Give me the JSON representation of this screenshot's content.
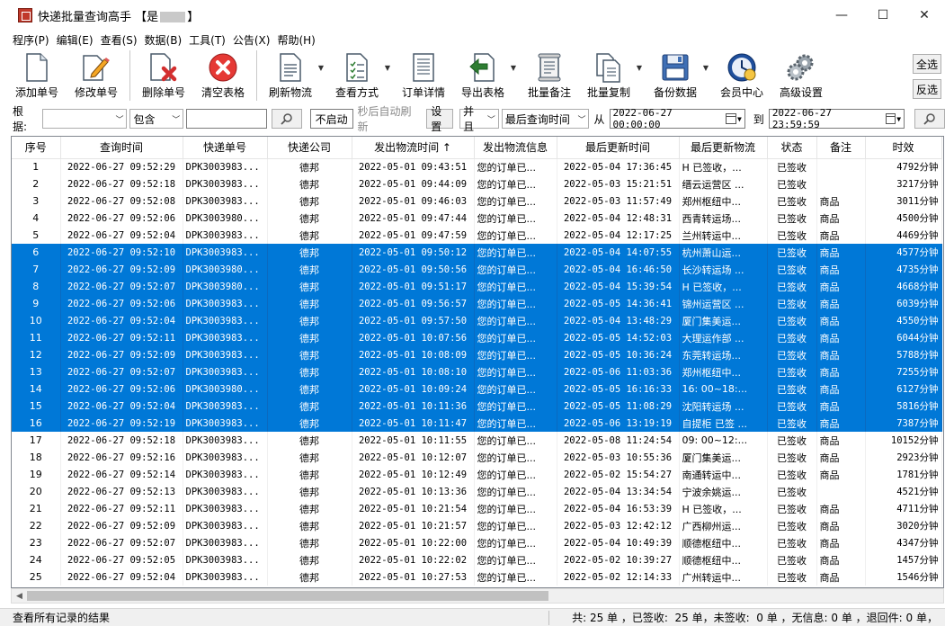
{
  "window": {
    "title_prefix": "快递批量查询高手 【是",
    "title_suffix": "】",
    "minimize": "—",
    "maximize": "☐",
    "close": "✕"
  },
  "menu": [
    "程序(P)",
    "编辑(E)",
    "查看(S)",
    "数据(B)",
    "工具(T)",
    "公告(X)",
    "帮助(H)"
  ],
  "toolbar": {
    "add": "添加单号",
    "edit": "修改单号",
    "delete": "删除单号",
    "clear": "清空表格",
    "refresh": "刷新物流",
    "view": "查看方式",
    "detail": "订单详情",
    "export": "导出表格",
    "batch_note": "批量备注",
    "batch_copy": "批量复制",
    "backup": "备份数据",
    "member": "会员中心",
    "advanced": "高级设置",
    "select_all": "全选",
    "invert": "反选"
  },
  "filter": {
    "basis_label": "根据:",
    "basis_value": "",
    "match_value": "包含",
    "search_text": "",
    "auto_toggle": "不启动",
    "auto_hint": "秒后自动刷新",
    "settings": "设置",
    "logic": "并且",
    "time_field": "最后查询时间",
    "from_label": "从",
    "from_date": "2022-06-27 00:00:00",
    "to_label": "到",
    "to_date": "2022-06-27 23:59:59"
  },
  "columns": [
    "序号",
    "查询时间",
    "快递单号",
    "快递公司",
    "发出物流时间 ↑",
    "发出物流信息",
    "最后更新时间",
    "最后更新物流",
    "状态",
    "备注",
    "时效"
  ],
  "rows": [
    [
      "1",
      "2022-06-27 09:52:29",
      "DPK3003983...",
      "德邦",
      "2022-05-01 09:43:51",
      "您的订单已...",
      "2022-05-04 17:36:45",
      "H 已签收，...",
      "已签收",
      "",
      "4792分钟"
    ],
    [
      "2",
      "2022-06-27 09:52:18",
      "DPK3003983...",
      "德邦",
      "2022-05-01 09:44:09",
      "您的订单已...",
      "2022-05-03 15:21:51",
      "缙云运营区 ...",
      "已签收",
      "",
      "3217分钟"
    ],
    [
      "3",
      "2022-06-27 09:52:08",
      "DPK3003983...",
      "德邦",
      "2022-05-01 09:46:03",
      "您的订单已...",
      "2022-05-03 11:57:49",
      "郑州枢纽中...",
      "已签收",
      "商品",
      "3011分钟"
    ],
    [
      "4",
      "2022-06-27 09:52:06",
      "DPK3003980...",
      "德邦",
      "2022-05-01 09:47:44",
      "您的订单已...",
      "2022-05-04 12:48:31",
      "西青转运场...",
      "已签收",
      "商品",
      "4500分钟"
    ],
    [
      "5",
      "2022-06-27 09:52:04",
      "DPK3003983...",
      "德邦",
      "2022-05-01 09:47:59",
      "您的订单已...",
      "2022-05-04 12:17:25",
      "兰州转运中...",
      "已签收",
      "商品",
      "4469分钟"
    ],
    [
      "6",
      "2022-06-27 09:52:10",
      "DPK3003983...",
      "德邦",
      "2022-05-01 09:50:12",
      "您的订单已...",
      "2022-05-04 14:07:55",
      "杭州萧山运...",
      "已签收",
      "商品",
      "4577分钟"
    ],
    [
      "7",
      "2022-06-27 09:52:09",
      "DPK3003980...",
      "德邦",
      "2022-05-01 09:50:56",
      "您的订单已...",
      "2022-05-04 16:46:50",
      "长沙转运场 ...",
      "已签收",
      "商品",
      "4735分钟"
    ],
    [
      "8",
      "2022-06-27 09:52:07",
      "DPK3003980...",
      "德邦",
      "2022-05-01 09:51:17",
      "您的订单已...",
      "2022-05-04 15:39:54",
      "H 已签收，...",
      "已签收",
      "商品",
      "4668分钟"
    ],
    [
      "9",
      "2022-06-27 09:52:06",
      "DPK3003983...",
      "德邦",
      "2022-05-01 09:56:57",
      "您的订单已...",
      "2022-05-05 14:36:41",
      "锦州运营区 ...",
      "已签收",
      "商品",
      "6039分钟"
    ],
    [
      "10",
      "2022-06-27 09:52:04",
      "DPK3003983...",
      "德邦",
      "2022-05-01 09:57:50",
      "您的订单已...",
      "2022-05-04 13:48:29",
      "厦门集美运...",
      "已签收",
      "商品",
      "4550分钟"
    ],
    [
      "11",
      "2022-06-27 09:52:11",
      "DPK3003983...",
      "德邦",
      "2022-05-01 10:07:56",
      "您的订单已...",
      "2022-05-05 14:52:03",
      "大理运作部 ...",
      "已签收",
      "商品",
      "6044分钟"
    ],
    [
      "12",
      "2022-06-27 09:52:09",
      "DPK3003983...",
      "德邦",
      "2022-05-01 10:08:09",
      "您的订单已...",
      "2022-05-05 10:36:24",
      "东莞转运场...",
      "已签收",
      "商品",
      "5788分钟"
    ],
    [
      "13",
      "2022-06-27 09:52:07",
      "DPK3003983...",
      "德邦",
      "2022-05-01 10:08:10",
      "您的订单已...",
      "2022-05-06 11:03:36",
      "郑州枢纽中...",
      "已签收",
      "商品",
      "7255分钟"
    ],
    [
      "14",
      "2022-06-27 09:52:06",
      "DPK3003980...",
      "德邦",
      "2022-05-01 10:09:24",
      "您的订单已...",
      "2022-05-05 16:16:33",
      "16: 00~18:...",
      "已签收",
      "商品",
      "6127分钟"
    ],
    [
      "15",
      "2022-06-27 09:52:04",
      "DPK3003983...",
      "德邦",
      "2022-05-01 10:11:36",
      "您的订单已...",
      "2022-05-05 11:08:29",
      "沈阳转运场 ...",
      "已签收",
      "商品",
      "5816分钟"
    ],
    [
      "16",
      "2022-06-27 09:52:19",
      "DPK3003983...",
      "德邦",
      "2022-05-01 10:11:47",
      "您的订单已...",
      "2022-05-06 13:19:19",
      "自提柜 已签 ...",
      "已签收",
      "商品",
      "7387分钟"
    ],
    [
      "17",
      "2022-06-27 09:52:18",
      "DPK3003983...",
      "德邦",
      "2022-05-01 10:11:55",
      "您的订单已...",
      "2022-05-08 11:24:54",
      "09: 00~12:...",
      "已签收",
      "商品",
      "10152分钟"
    ],
    [
      "18",
      "2022-06-27 09:52:16",
      "DPK3003983...",
      "德邦",
      "2022-05-01 10:12:07",
      "您的订单已...",
      "2022-05-03 10:55:36",
      "厦门集美运...",
      "已签收",
      "商品",
      "2923分钟"
    ],
    [
      "19",
      "2022-06-27 09:52:14",
      "DPK3003983...",
      "德邦",
      "2022-05-01 10:12:49",
      "您的订单已...",
      "2022-05-02 15:54:27",
      "南通转运中...",
      "已签收",
      "商品",
      "1781分钟"
    ],
    [
      "20",
      "2022-06-27 09:52:13",
      "DPK3003983...",
      "德邦",
      "2022-05-01 10:13:36",
      "您的订单已...",
      "2022-05-04 13:34:54",
      "宁波余姚运...",
      "已签收",
      "",
      "4521分钟"
    ],
    [
      "21",
      "2022-06-27 09:52:11",
      "DPK3003983...",
      "德邦",
      "2022-05-01 10:21:54",
      "您的订单已...",
      "2022-05-04 16:53:39",
      "H 已签收，...",
      "已签收",
      "商品",
      "4711分钟"
    ],
    [
      "22",
      "2022-06-27 09:52:09",
      "DPK3003983...",
      "德邦",
      "2022-05-01 10:21:57",
      "您的订单已...",
      "2022-05-03 12:42:12",
      "广西柳州运...",
      "已签收",
      "商品",
      "3020分钟"
    ],
    [
      "23",
      "2022-06-27 09:52:07",
      "DPK3003983...",
      "德邦",
      "2022-05-01 10:22:00",
      "您的订单已...",
      "2022-05-04 10:49:39",
      "顺德枢纽中...",
      "已签收",
      "商品",
      "4347分钟"
    ],
    [
      "24",
      "2022-06-27 09:52:05",
      "DPK3003983...",
      "德邦",
      "2022-05-01 10:22:02",
      "您的订单已...",
      "2022-05-02 10:39:27",
      "顺德枢纽中...",
      "已签收",
      "商品",
      "1457分钟"
    ],
    [
      "25",
      "2022-06-27 09:52:04",
      "DPK3003983...",
      "德邦",
      "2022-05-01 10:27:53",
      "您的订单已...",
      "2022-05-02 12:14:33",
      "广州转运中...",
      "已签收",
      "商品",
      "1546分钟"
    ]
  ],
  "selected_rows": [
    6,
    7,
    8,
    9,
    10,
    11,
    12,
    13,
    14,
    15,
    16
  ],
  "status": {
    "left": "查看所有记录的结果",
    "right": "共: 25 单 ，已签收:  25 单，未签收:  0 单 ，无信息: 0 单 ，退回件: 0 单，"
  },
  "colors": {
    "selection": "#0078d7",
    "delete_icon": "#d32f2f",
    "clear_icon": "#e53935",
    "export_icon": "#2e7d32"
  }
}
